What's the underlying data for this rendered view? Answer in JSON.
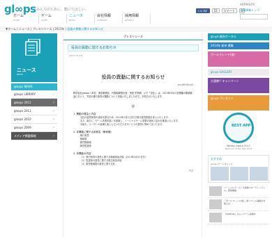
{
  "header": {
    "logo": "gl∞ps",
    "tagline": "みんなのために、動いてほしい。",
    "site_name": "ASTARSITE",
    "corp_link": "企業情報トップ",
    "nav": [
      {
        "jp": "ホーム",
        "en": "HOME"
      },
      {
        "jp": "ゲーム",
        "en": "GAME"
      },
      {
        "jp": "ニュース",
        "en": "NEWS"
      },
      {
        "jp": "会社情報",
        "en": "COMPANY"
      },
      {
        "jp": "採用情報",
        "en": "RECRUIT"
      }
    ],
    "social": {
      "fb": "いいね!",
      "fb_count": "15",
      "tweet": "ツイート",
      "tweet_count": "0"
    }
  },
  "breadcrumb": {
    "trail": "▼ホーム | ニュース | プレスリリース | 2013年 | ",
    "current": "役員の異動に関するお知らせ"
  },
  "sidebar": {
    "title": "ニュース",
    "subtitle": "NEWS",
    "head": "gloops NEWS",
    "items": [
      {
        "label": "gloops LIBRARY"
      },
      {
        "label": "gloops 2012",
        "active": true
      },
      {
        "label": "gloops 2011"
      },
      {
        "label": "gloops 2010"
      },
      {
        "label": "gloops 2009"
      },
      {
        "label": "メディア掲載情報",
        "dark": true
      }
    ]
  },
  "main": {
    "section_label": "プレスリリース",
    "article_title": "役員の異動に関するお知らせ",
    "date": "[2013.03.22]",
    "doc_title": "役員の異動に関するお知らせ",
    "doc_date": "2013年3月22日",
    "intro": "株式会社gloops（本社：東京都港区、代表取締役社長：池田 宗多朗、以下「当社」）は、2013年3月21日開催の取締役会において、下記の通り役員の異動について決議いたしましたので、お知らせいたします。",
    "ki": "記",
    "sections": [
      {
        "head": "1. 異動の理由と内容",
        "lines": [
          "当社の経営体制の強化を図るため、2013年3月21日付で執行役員制度を導入いたします。",
          "また、新たに「ゲーム事業本部」を設置し、ソーシャルゲーム事業の強化と拡大を推進いたします。",
          "今後も、ユーザーの皆様に楽しんでいただけるサービスの提供に努めてまいります。"
        ]
      },
      {
        "head": "2. 本異動に関する役員名（敬称略）",
        "lines": [
          "執行役員",
          "取締役",
          "新任取締役",
          "新任監査役"
        ]
      },
      {
        "head": "3. 本異動の内容",
        "lines": [
          "（1）執行役員の選任に関する取締役会決議（2013年3月21日付）",
          "（2）監査役の選任に関する株主総会決議",
          "（3）新任取締役の就任に関する件"
        ]
      }
    ],
    "closing": "以上"
  },
  "right": {
    "banners": [
      "gl∞ps 総合ポータル",
      "2014年 新卒 募集",
      "ガールフレンド(仮)",
      "gl∞ps GALLERY",
      "大連携!! キャンペーン",
      "gl∞ps プレゼント"
    ],
    "award_badge": "BEST APP",
    "award_title": "Webby Award 2011",
    "award_sub": "Platinum of the Year 2011",
    "pick_head": "おすすめ",
    "pick_sub": "gloops ゲームタイトル",
    "list_items": [
      "ソーシャルゲーム「大連携!!オーディンバトル」配信開始",
      "「ガールフレンド(仮)」新イベント開催のお知らせ",
      "「SHINOBI」キャンペーン実施中"
    ]
  }
}
